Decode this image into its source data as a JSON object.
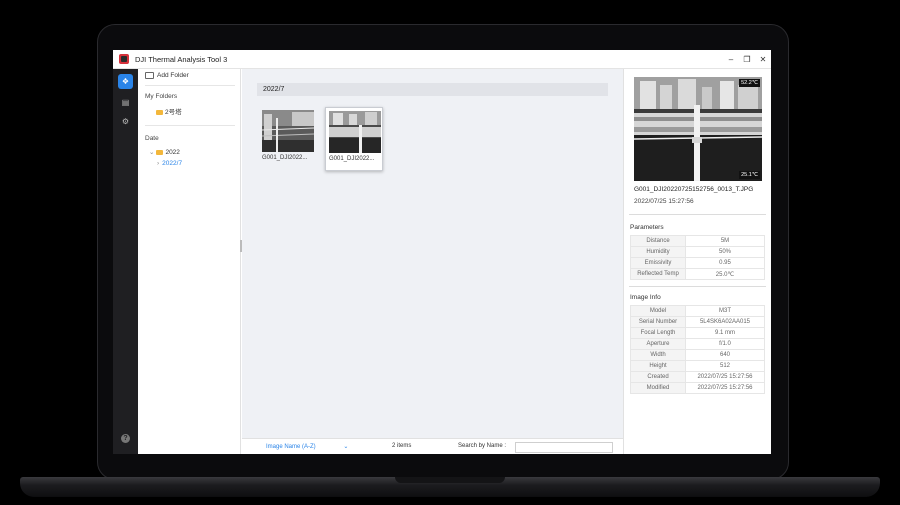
{
  "window": {
    "title": "DJI Thermal Analysis Tool 3"
  },
  "nav": {
    "icons": [
      "gallery-icon",
      "report-icon",
      "settings-icon",
      "help-icon"
    ]
  },
  "sidebar": {
    "add_folder_label": "Add Folder",
    "my_folders_label": "My Folders",
    "my_folders_items": [
      "2号塔"
    ],
    "date_label": "Date",
    "date_year": "2022",
    "date_month": "2022/7"
  },
  "main": {
    "group_header": "2022/7",
    "thumbnails": [
      {
        "label": "G001_DJI2022...",
        "selected": false
      },
      {
        "label": "G001_DJI2022...",
        "selected": true
      }
    ]
  },
  "statusbar": {
    "sort_label": "Image Name (A-Z)",
    "count_text": "2 items",
    "search_label": "Search by Name :",
    "search_value": ""
  },
  "preview": {
    "temp_max": "52.2℃",
    "temp_min": "25.1℃",
    "filename": "G001_DJI20220725152756_0013_T.JPG",
    "datetime": "2022/07/25 15:27:56"
  },
  "parameters": {
    "title": "Parameters",
    "rows": [
      {
        "k": "Distance",
        "v": "5M"
      },
      {
        "k": "Humidity",
        "v": "50%"
      },
      {
        "k": "Emissivity",
        "v": "0.95"
      },
      {
        "k": "Reflected Temp",
        "v": "25.0℃"
      }
    ]
  },
  "image_info": {
    "title": "Image Info",
    "rows": [
      {
        "k": "Model",
        "v": "M3T"
      },
      {
        "k": "Serial Number",
        "v": "5L4SK6A02AA015"
      },
      {
        "k": "Focal Length",
        "v": "9.1 mm"
      },
      {
        "k": "Aperture",
        "v": "f/1.0"
      },
      {
        "k": "Width",
        "v": "640"
      },
      {
        "k": "Height",
        "v": "512"
      },
      {
        "k": "Created",
        "v": "2022/07/25 15:27:56"
      },
      {
        "k": "Modified",
        "v": "2022/07/25 15:27:56"
      }
    ]
  },
  "colors": {
    "accent": "#2a84e8",
    "nav_bg": "#1f1f22",
    "main_bg": "#eff1f5"
  }
}
